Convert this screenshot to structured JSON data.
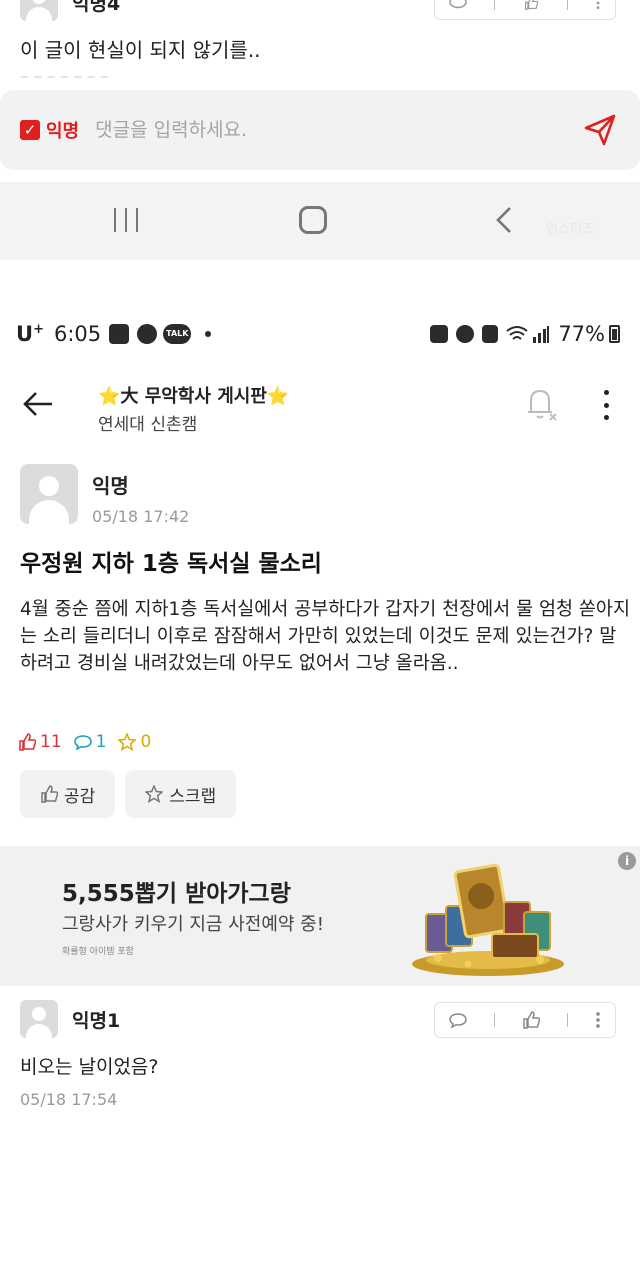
{
  "prev_comment": {
    "author": "익명4",
    "text": "이 글이 현실이 되지 않기를.."
  },
  "comment_input": {
    "anon_label": "익명",
    "placeholder": "댓글을 입력하세요."
  },
  "watermark": "인스티즈",
  "status_bar": {
    "carrier": "U",
    "carrier_sup": "+",
    "time": "6:05",
    "talk_badge": "TALK",
    "battery": "77%"
  },
  "header": {
    "title": "大 무악학사 게시판",
    "star_glyph": "⭐",
    "subtitle": "연세대 신촌캠"
  },
  "post": {
    "author": "익명",
    "time": "05/18 17:42",
    "title": "우정원 지하 1층 독서실 물소리",
    "body": "4월 중순 쯤에 지하1층 독서실에서 공부하다가 갑자기 천장에서 물 엄청 쏟아지는 소리 들리더니 이후로 잠잠해서 가만히 있었는데 이것도 문제 있는건가? 말하려고 경비실 내려갔었는데 아무도 없어서 그냥 올라옴..",
    "stats": {
      "likes": "11",
      "comments": "1",
      "scraps": "0"
    },
    "like_button": "공감",
    "scrap_button": "스크랩"
  },
  "ad": {
    "title": "5,555뽑기 받아가그랑",
    "subtitle": "그랑사가 키우기 지금 사전예약 중!",
    "small_print": "확률형 아이템 포함",
    "info_icon": "i"
  },
  "comment1": {
    "author": "익명1",
    "text": "비오는 날이었음?",
    "time": "05/18 17:54"
  },
  "colors": {
    "accent_red": "#e02020",
    "comment_teal": "#18a3b5",
    "scrap_gold": "#d7aa00",
    "star_yellow": "#f5c400"
  }
}
